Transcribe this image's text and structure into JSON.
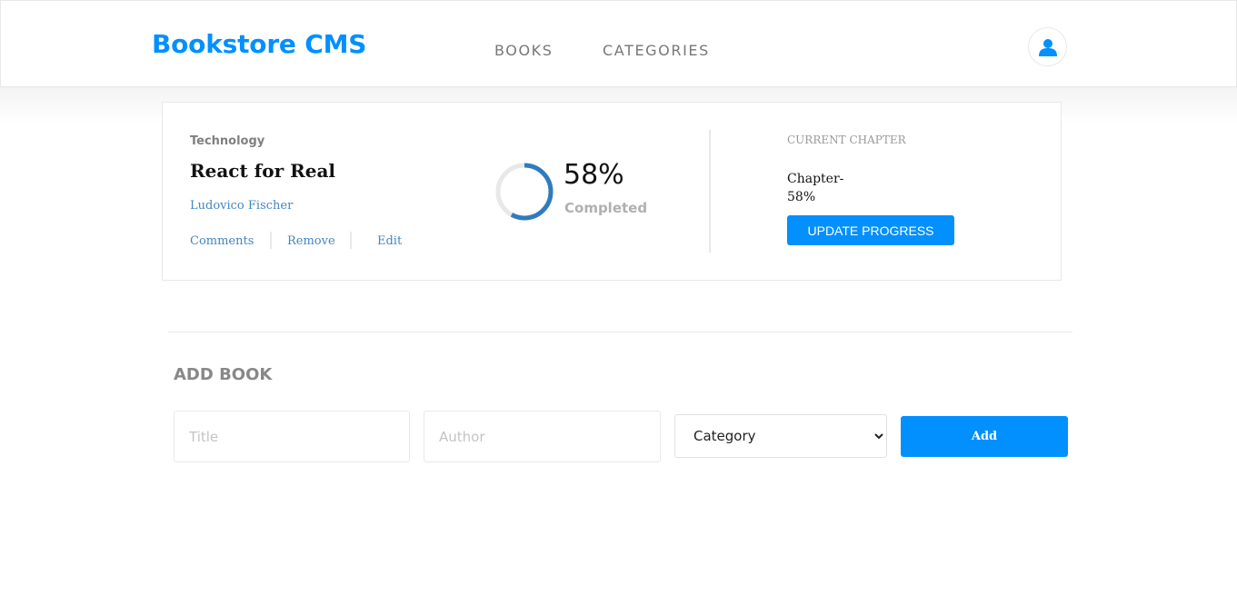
{
  "header": {
    "logo": "Bookstore CMS",
    "nav": [
      {
        "label": "BOOKS"
      },
      {
        "label": "CATEGORIES"
      }
    ],
    "avatar_icon": "user-icon"
  },
  "book": {
    "category": "Technology",
    "title": "React for Real",
    "author": "Ludovico Fischer",
    "actions": {
      "comments": "Comments",
      "remove": "Remove",
      "edit": "Edit"
    },
    "progress": {
      "percent": 58,
      "percent_text": "58%",
      "label": "Completed"
    },
    "current_chapter": {
      "label": "CURRENT CHAPTER",
      "value": "Chapter- 58%",
      "button": "UPDATE PROGRESS"
    }
  },
  "add_book": {
    "heading": "ADD BOOK",
    "title_placeholder": "Title",
    "author_placeholder": "Author",
    "category_selected": "Category",
    "add_button": "Add"
  },
  "colors": {
    "accent": "#0290ff",
    "progress": "#307bbe",
    "progress_track": "#e8e8e8",
    "link": "#4386bf"
  }
}
